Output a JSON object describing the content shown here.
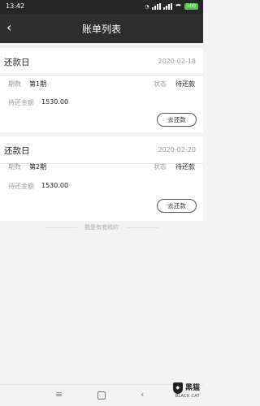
{
  "status": {
    "time": "13:42",
    "battery": "100"
  },
  "header": {
    "title": "账单列表",
    "back_icon": "chevron-left-icon"
  },
  "bills": [
    {
      "heading": "还款日",
      "date": "2020-02-18",
      "period_label": "期数",
      "period_value": "第1期",
      "state_label": "状态",
      "state_value": "待还款",
      "amount_label": "待还金额",
      "amount_value": "1530.00",
      "button_label": "去还款"
    },
    {
      "heading": "还款日",
      "date": "2020-02-20",
      "period_label": "期数",
      "period_value": "第2期",
      "state_label": "状态",
      "state_value": "待还款",
      "amount_label": "待还金额",
      "amount_value": "1530.00",
      "button_label": "去还款"
    }
  ],
  "footer_note": "我是有底线的",
  "watermark": {
    "main": "黑猫",
    "sub": "BLACK CAT"
  }
}
